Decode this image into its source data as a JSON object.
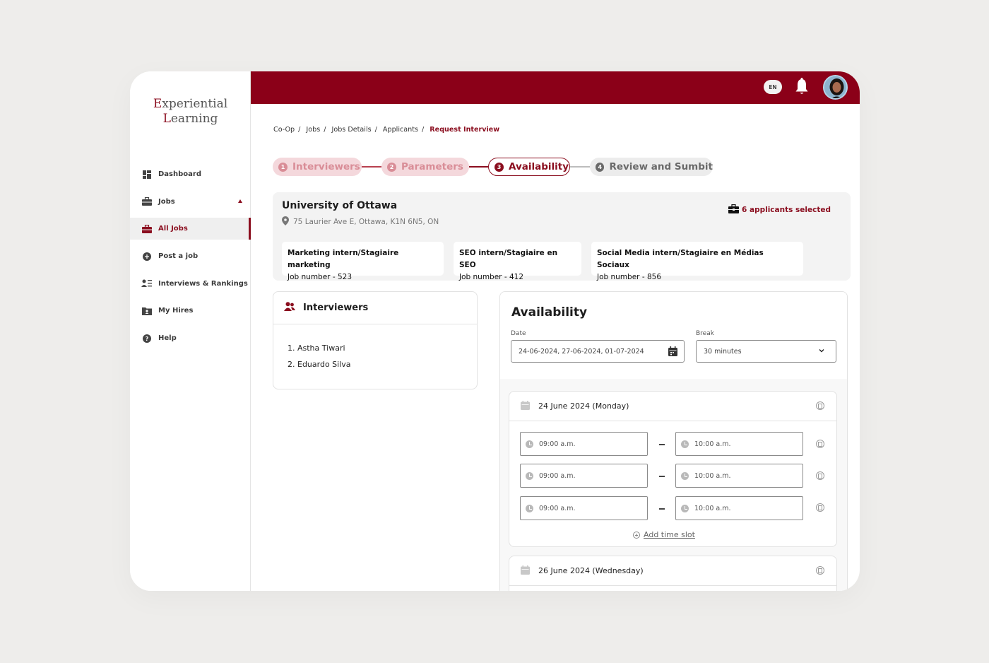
{
  "logo": {
    "line1_cap": "E",
    "line1_rest": "xperiential",
    "line2_cap": "L",
    "line2_rest": "earning"
  },
  "topbar": {
    "lang": "EN"
  },
  "sidebar": {
    "items": [
      {
        "label": "Dashboard",
        "icon": "dashboard-icon"
      },
      {
        "label": "Jobs",
        "icon": "briefcase-icon"
      },
      {
        "label": "All Jobs",
        "icon": "briefcase-icon",
        "active": true
      },
      {
        "label": "Post a job",
        "icon": "plus-circle-icon"
      },
      {
        "label": "Interviews & Rankings",
        "icon": "ranking-icon"
      },
      {
        "label": "My Hires",
        "icon": "folder-user-icon"
      },
      {
        "label": "Help",
        "icon": "help-icon"
      }
    ]
  },
  "breadcrumb": [
    "Co-Op",
    "Jobs",
    "Jobs Details",
    "Applicants",
    "Request Interview"
  ],
  "steps": [
    {
      "num": "1",
      "label": "Interviewers",
      "state": "done"
    },
    {
      "num": "2",
      "label": "Parameters",
      "state": "done"
    },
    {
      "num": "3",
      "label": "Availability",
      "state": "current"
    },
    {
      "num": "4",
      "label": "Review and Sumbit",
      "state": "next"
    }
  ],
  "university": {
    "name": "University of Ottawa",
    "address": "75 Laurier Ave E, Ottawa, K1N 6N5, ON",
    "selected": "6 applicants selected",
    "jobs": [
      {
        "title": "Marketing intern/Stagiaire marketing",
        "number": "Job number - 523"
      },
      {
        "title": "SEO intern/Stagiaire en SEO",
        "number": "Job number - 412"
      },
      {
        "title": "Social Media intern/Stagiaire en Médias Sociaux",
        "number": "Job number - 856"
      }
    ]
  },
  "interviewers": {
    "title": "Interviewers",
    "list": [
      "1. Astha Tiwari",
      "2. Eduardo Silva"
    ]
  },
  "availability": {
    "title": "Availability",
    "date_label": "Date",
    "date_value": "24-06-2024, 27-06-2024, 01-07-2024",
    "break_label": "Break",
    "break_value": "30 minutes",
    "days": [
      {
        "label": "24 June 2024 (Monday)",
        "slots": [
          {
            "start": "09:00 a.m.",
            "end": "10:00 a.m."
          },
          {
            "start": "09:00 a.m.",
            "end": "10:00 a.m."
          },
          {
            "start": "09:00 a.m.",
            "end": "10:00 a.m."
          }
        ],
        "add_label": "Add time slot"
      },
      {
        "label": "26 June 2024 (Wednesday)"
      }
    ]
  },
  "colors": {
    "brand": "#8b0018",
    "accent": "#8b0e1f"
  }
}
